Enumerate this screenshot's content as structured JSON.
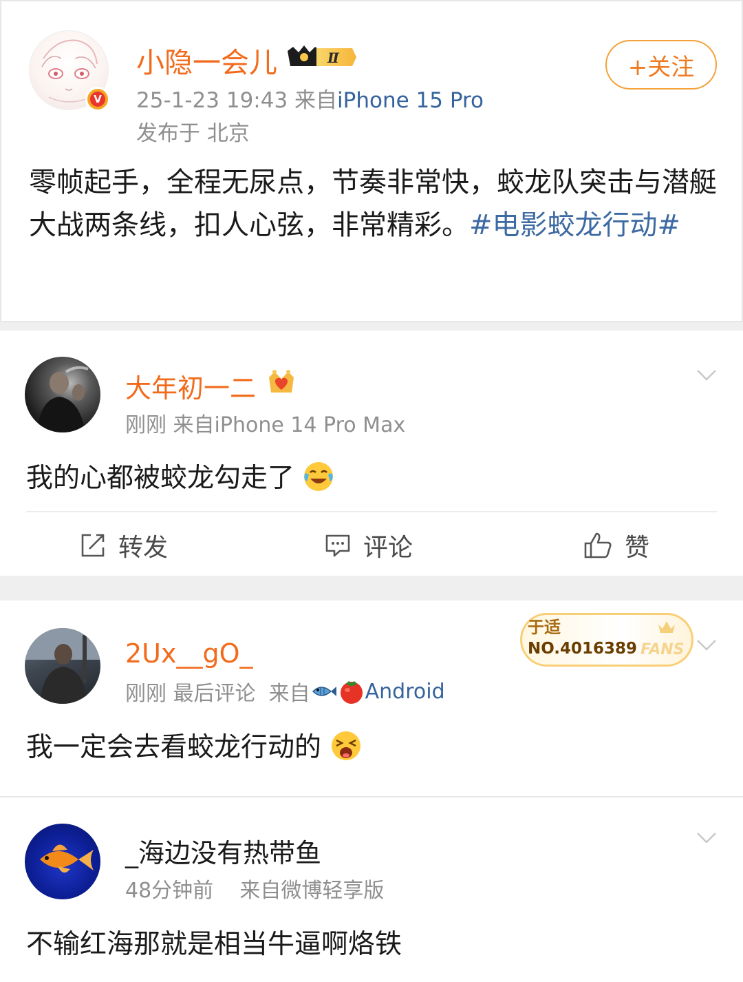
{
  "post": {
    "username": "小隐一会儿",
    "vip_level": "Ⅱ",
    "timestamp": "25-1-23 19:43",
    "source_prefix": "来自",
    "device": "iPhone 15 Pro",
    "location": "发布于 北京",
    "follow_label": "+关注",
    "text": "零帧起手，全程无尿点，节奏非常快，蛟龙队突击与潜艇大战两条线，扣人心弦，非常精彩。",
    "topic": "#电影蛟龙行动#",
    "icons": [
      "verified-v-icon",
      "vip-crown-icon"
    ]
  },
  "comments": [
    {
      "username": "大年初一二",
      "time": "刚刚",
      "source_prefix": "来自",
      "device": "iPhone 14 Pro Max",
      "text": "我的心都被蛟龙勾走了",
      "emoji": "laugh-cry-emoji",
      "badge_icon": "heart-crown-icon",
      "actions": {
        "repost": "转发",
        "comment": "评论",
        "like": "赞"
      }
    },
    {
      "username": "2Ux__gO_",
      "time": "刚刚",
      "last_comment": "最后评论",
      "source_prefix": "来自",
      "device": "Android",
      "text": "我一定会去看蛟龙行动的",
      "emoji": "crying-emoji",
      "fans_badge": {
        "brand": "于适",
        "number": "NO.4016389",
        "word": "FANS"
      }
    },
    {
      "username": "_海边没有热带鱼",
      "time": "48分钟前",
      "source": "来自微博轻享版",
      "text": "不输红海那就是相当牛逼啊烙铁"
    }
  ],
  "colors": {
    "name_orange": "#f26b1c",
    "link_blue": "#35639e",
    "meta_gray": "#8f8f8f",
    "divider": "#efefef"
  }
}
